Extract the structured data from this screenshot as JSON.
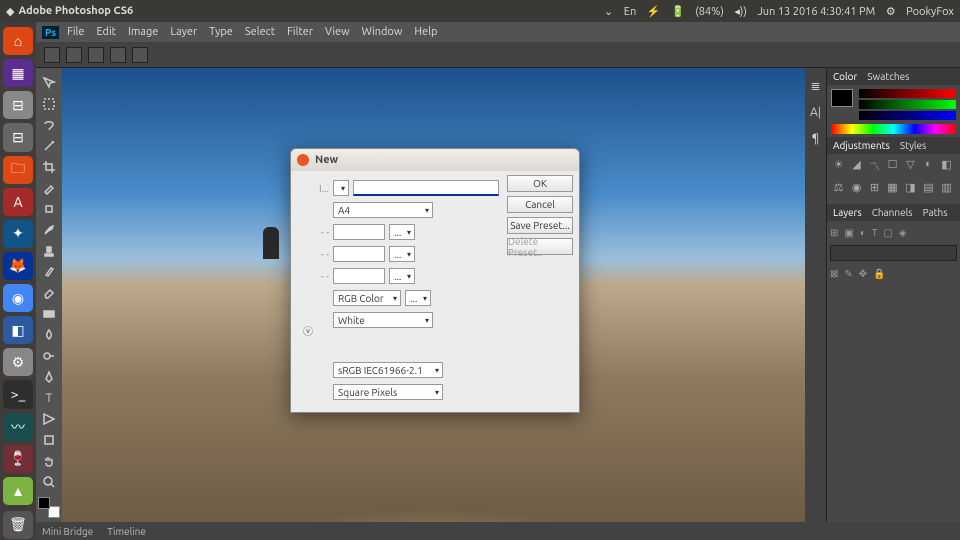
{
  "ubuntu": {
    "title": "Adobe Photoshop CS6",
    "tray": {
      "wifi": "⌄",
      "lang": "En",
      "bt": "⚡",
      "battery": "(84%)",
      "vol": "◂))",
      "date": "Jun 13 2016  4:30:41 PM",
      "gear": "⚙",
      "user": "PookyFox"
    }
  },
  "menu": {
    "items": [
      "File",
      "Edit",
      "Image",
      "Layer",
      "Type",
      "Select",
      "Filter",
      "View",
      "Window",
      "Help"
    ]
  },
  "bottom": {
    "items": [
      "Mini Bridge",
      "Timeline"
    ]
  },
  "panels": {
    "color": {
      "tabs": [
        "Color",
        "Swatches"
      ]
    },
    "adjustments": {
      "tabs": [
        "Adjustments",
        "Styles"
      ]
    },
    "layers": {
      "tabs": [
        "Layers",
        "Channels",
        "Paths"
      ]
    }
  },
  "dialog": {
    "title": "New",
    "name_label": "I...",
    "preset": "A4",
    "width": "...",
    "height": "...",
    "res": "...",
    "color_mode": "RGB Color",
    "depth": "...",
    "background": "White",
    "profile": "sRGB IEC61966-2.1",
    "pixel_aspect": "Square Pixels",
    "buttons": {
      "ok": "OK",
      "cancel": "Cancel",
      "save_preset": "Save Preset...",
      "delete_preset": "Delete Preset.."
    }
  }
}
